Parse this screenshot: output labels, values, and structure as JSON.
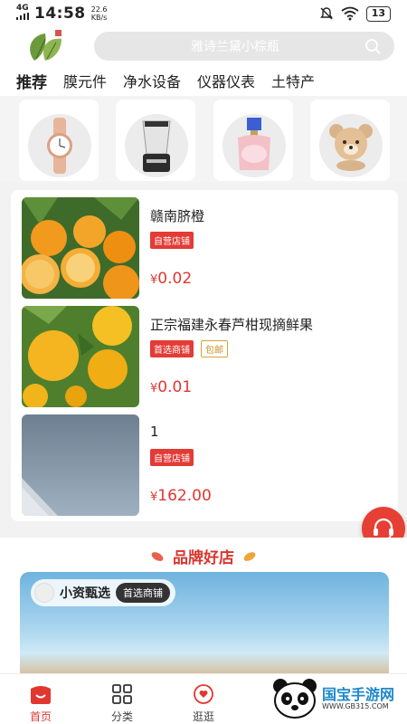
{
  "status_bar": {
    "network": "4G",
    "clock": "14:58",
    "speed_value": "22.6",
    "speed_unit": "KB/s",
    "battery": "13"
  },
  "header": {
    "search_placeholder": "雅诗兰黛小棕瓶"
  },
  "tabs": [
    "推荐",
    "膜元件",
    "净水设备",
    "仪器仪表",
    "土特产"
  ],
  "categories": [
    {
      "icon": "watch-icon"
    },
    {
      "icon": "blender-icon"
    },
    {
      "icon": "perfume-icon"
    },
    {
      "icon": "teddy-bear-icon"
    }
  ],
  "products": [
    {
      "title": "赣南脐橙",
      "badges": [
        {
          "label": "自营店铺",
          "style": "red"
        }
      ],
      "currency": "¥",
      "price": "0.02",
      "image": "navel-orange-image"
    },
    {
      "title": "正宗福建永春芦柑现摘鲜果",
      "badges": [
        {
          "label": "首选商铺",
          "style": "red"
        },
        {
          "label": "包邮",
          "style": "gold"
        }
      ],
      "currency": "¥",
      "price": "0.01",
      "image": "tangerine-image"
    },
    {
      "title": "1",
      "badges": [
        {
          "label": "自营店铺",
          "style": "red"
        }
      ],
      "currency": "¥",
      "price": "162.00",
      "image": "building-sky-image"
    }
  ],
  "brand": {
    "title": "品牌好店",
    "store_name": "小资甄选",
    "store_badge": "首选商铺"
  },
  "nav": {
    "home": "首页",
    "category": "分类",
    "browse": "逛逛"
  },
  "watermark": {
    "text": "国宝手游网",
    "url": "WWW.GB315.COM"
  },
  "colors": {
    "accent": "#e03730",
    "badge_red": "#e33b36",
    "badge_gold": "#c89226"
  }
}
